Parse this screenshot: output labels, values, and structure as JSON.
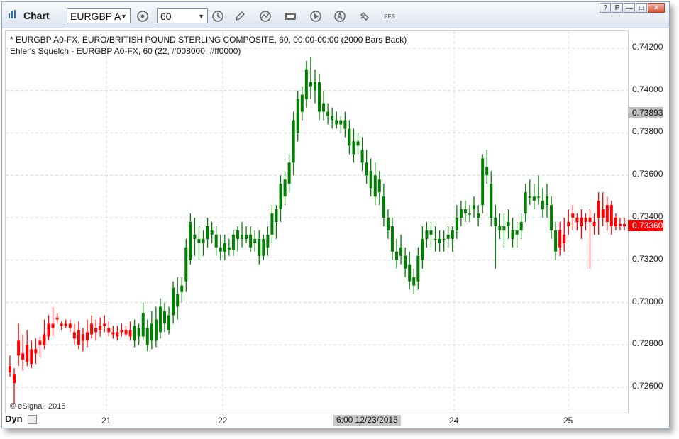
{
  "window": {
    "title": "Chart",
    "symbol": "EURGBP A",
    "interval": "60",
    "toolbar_efs": "EFS",
    "win_help": "?",
    "win_link": "P",
    "win_min": "—",
    "win_max": "□",
    "win_close": "✕"
  },
  "legend": {
    "line1": "* EURGBP A0-FX, EURO/BRITISH POUND STERLING COMPOSITE, 60, 00:00-00:00 (2000 Bars Back)",
    "line2": "Ehler's Squelch - EURGBP A0-FX, 60 (22, #008000, #ff0000)"
  },
  "footer": {
    "copyright": "© eSignal, 2015",
    "dyn": "Dyn",
    "crosshair_date": "6:00 12/23/2015"
  },
  "colors": {
    "up": "#008000",
    "down": "#ff0000",
    "grid": "#d8d8d8",
    "current_tag": "#ff0000",
    "crosshair_tag": "#c0c0c0"
  },
  "chart_data": {
    "type": "ohlc-bar",
    "y_ticks": [
      "0.72600",
      "0.72800",
      "0.73000",
      "0.73200",
      "0.73400",
      "0.73600",
      "0.73800",
      "0.74000",
      "0.74200"
    ],
    "ylim": [
      0.7248,
      0.7428
    ],
    "x_ticks": [
      "21",
      "22",
      "24",
      "25"
    ],
    "crosshair_price": "0.73893",
    "last_price": "0.73360",
    "series": [
      {
        "c": "r",
        "o": 0.727,
        "h": 0.7275,
        "l": 0.7265,
        "cl": 0.7267
      },
      {
        "c": "r",
        "o": 0.7266,
        "h": 0.7269,
        "l": 0.7252,
        "cl": 0.7262
      },
      {
        "c": "r",
        "o": 0.7282,
        "h": 0.729,
        "l": 0.727,
        "cl": 0.7275
      },
      {
        "c": "r",
        "o": 0.7273,
        "h": 0.7285,
        "l": 0.7268,
        "cl": 0.7276
      },
      {
        "c": "r",
        "o": 0.728,
        "h": 0.7287,
        "l": 0.727,
        "cl": 0.7272
      },
      {
        "c": "r",
        "o": 0.7278,
        "h": 0.7282,
        "l": 0.7269,
        "cl": 0.7271
      },
      {
        "c": "r",
        "o": 0.7278,
        "h": 0.7283,
        "l": 0.7271,
        "cl": 0.7276
      },
      {
        "c": "r",
        "o": 0.728,
        "h": 0.7284,
        "l": 0.7274,
        "cl": 0.7282
      },
      {
        "c": "r",
        "o": 0.7285,
        "h": 0.7292,
        "l": 0.7278,
        "cl": 0.728
      },
      {
        "c": "r",
        "o": 0.729,
        "h": 0.7294,
        "l": 0.7282,
        "cl": 0.7284
      },
      {
        "c": "r",
        "o": 0.729,
        "h": 0.7298,
        "l": 0.7284,
        "cl": 0.7288
      },
      {
        "c": "r",
        "o": 0.7293,
        "h": 0.7295,
        "l": 0.729,
        "cl": 0.7292
      },
      {
        "c": "r",
        "o": 0.7289,
        "h": 0.7291,
        "l": 0.7287,
        "cl": 0.729
      },
      {
        "c": "r",
        "o": 0.729,
        "h": 0.7292,
        "l": 0.7288,
        "cl": 0.7289
      },
      {
        "c": "r",
        "o": 0.729,
        "h": 0.7292,
        "l": 0.7286,
        "cl": 0.7288
      },
      {
        "c": "r",
        "o": 0.7286,
        "h": 0.729,
        "l": 0.728,
        "cl": 0.7283
      },
      {
        "c": "r",
        "o": 0.7287,
        "h": 0.7291,
        "l": 0.7278,
        "cl": 0.728
      },
      {
        "c": "r",
        "o": 0.7282,
        "h": 0.7288,
        "l": 0.7277,
        "cl": 0.7285
      },
      {
        "c": "r",
        "o": 0.7286,
        "h": 0.7292,
        "l": 0.7279,
        "cl": 0.7282
      },
      {
        "c": "r",
        "o": 0.729,
        "h": 0.7294,
        "l": 0.7283,
        "cl": 0.7285
      },
      {
        "c": "r",
        "o": 0.7286,
        "h": 0.7292,
        "l": 0.7282,
        "cl": 0.7288
      },
      {
        "c": "r",
        "o": 0.7289,
        "h": 0.7293,
        "l": 0.7284,
        "cl": 0.7287
      },
      {
        "c": "r",
        "o": 0.729,
        "h": 0.7294,
        "l": 0.7286,
        "cl": 0.7289
      },
      {
        "c": "r",
        "o": 0.7288,
        "h": 0.7291,
        "l": 0.7284,
        "cl": 0.7286
      },
      {
        "c": "r",
        "o": 0.7286,
        "h": 0.7289,
        "l": 0.7283,
        "cl": 0.7285
      },
      {
        "c": "r",
        "o": 0.7286,
        "h": 0.7289,
        "l": 0.7282,
        "cl": 0.7284
      },
      {
        "c": "r",
        "o": 0.7287,
        "h": 0.729,
        "l": 0.7284,
        "cl": 0.7286
      },
      {
        "c": "r",
        "o": 0.7287,
        "h": 0.7289,
        "l": 0.7284,
        "cl": 0.7285
      },
      {
        "c": "r",
        "o": 0.7287,
        "h": 0.7291,
        "l": 0.7282,
        "cl": 0.7284
      },
      {
        "c": "g",
        "o": 0.7282,
        "h": 0.7292,
        "l": 0.7279,
        "cl": 0.7289
      },
      {
        "c": "g",
        "o": 0.7284,
        "h": 0.729,
        "l": 0.728,
        "cl": 0.7288
      },
      {
        "c": "g",
        "o": 0.7284,
        "h": 0.73,
        "l": 0.7282,
        "cl": 0.7295
      },
      {
        "c": "g",
        "o": 0.728,
        "h": 0.7292,
        "l": 0.7277,
        "cl": 0.7288
      },
      {
        "c": "g",
        "o": 0.7282,
        "h": 0.7296,
        "l": 0.7278,
        "cl": 0.729
      },
      {
        "c": "g",
        "o": 0.7282,
        "h": 0.7298,
        "l": 0.7279,
        "cl": 0.7292
      },
      {
        "c": "g",
        "o": 0.7286,
        "h": 0.7302,
        "l": 0.7283,
        "cl": 0.7298
      },
      {
        "c": "g",
        "o": 0.729,
        "h": 0.73,
        "l": 0.7286,
        "cl": 0.7296
      },
      {
        "c": "g",
        "o": 0.7287,
        "h": 0.7298,
        "l": 0.7285,
        "cl": 0.7294
      },
      {
        "c": "g",
        "o": 0.7294,
        "h": 0.731,
        "l": 0.729,
        "cl": 0.7307
      },
      {
        "c": "g",
        "o": 0.7298,
        "h": 0.7312,
        "l": 0.7292,
        "cl": 0.7304
      },
      {
        "c": "g",
        "o": 0.7305,
        "h": 0.7312,
        "l": 0.73,
        "cl": 0.7308
      },
      {
        "c": "g",
        "o": 0.731,
        "h": 0.733,
        "l": 0.7305,
        "cl": 0.7326
      },
      {
        "c": "g",
        "o": 0.732,
        "h": 0.7342,
        "l": 0.7318,
        "cl": 0.7338
      },
      {
        "c": "g",
        "o": 0.733,
        "h": 0.734,
        "l": 0.7322,
        "cl": 0.7332
      },
      {
        "c": "g",
        "o": 0.7328,
        "h": 0.7336,
        "l": 0.732,
        "cl": 0.733
      },
      {
        "c": "g",
        "o": 0.7328,
        "h": 0.7334,
        "l": 0.7322,
        "cl": 0.733
      },
      {
        "c": "g",
        "o": 0.733,
        "h": 0.734,
        "l": 0.7326,
        "cl": 0.7336
      },
      {
        "c": "g",
        "o": 0.7334,
        "h": 0.7338,
        "l": 0.7328,
        "cl": 0.7332
      },
      {
        "c": "g",
        "o": 0.7332,
        "h": 0.7336,
        "l": 0.7322,
        "cl": 0.7326
      },
      {
        "c": "g",
        "o": 0.7326,
        "h": 0.7332,
        "l": 0.732,
        "cl": 0.7324
      },
      {
        "c": "g",
        "o": 0.7324,
        "h": 0.7332,
        "l": 0.732,
        "cl": 0.7328
      },
      {
        "c": "g",
        "o": 0.7326,
        "h": 0.733,
        "l": 0.7322,
        "cl": 0.7325
      },
      {
        "c": "g",
        "o": 0.7325,
        "h": 0.7334,
        "l": 0.7322,
        "cl": 0.7332
      },
      {
        "c": "g",
        "o": 0.733,
        "h": 0.7336,
        "l": 0.7324,
        "cl": 0.7334
      },
      {
        "c": "g",
        "o": 0.7332,
        "h": 0.7338,
        "l": 0.7326,
        "cl": 0.733
      },
      {
        "c": "g",
        "o": 0.733,
        "h": 0.7336,
        "l": 0.7328,
        "cl": 0.7332
      },
      {
        "c": "g",
        "o": 0.7332,
        "h": 0.7336,
        "l": 0.7324,
        "cl": 0.7326
      },
      {
        "c": "g",
        "o": 0.7328,
        "h": 0.7334,
        "l": 0.7324,
        "cl": 0.733
      },
      {
        "c": "g",
        "o": 0.733,
        "h": 0.7334,
        "l": 0.7318,
        "cl": 0.7322
      },
      {
        "c": "g",
        "o": 0.7322,
        "h": 0.7332,
        "l": 0.732,
        "cl": 0.733
      },
      {
        "c": "g",
        "o": 0.7326,
        "h": 0.7336,
        "l": 0.7322,
        "cl": 0.7332
      },
      {
        "c": "g",
        "o": 0.7332,
        "h": 0.7346,
        "l": 0.7328,
        "cl": 0.7342
      },
      {
        "c": "g",
        "o": 0.7338,
        "h": 0.7346,
        "l": 0.733,
        "cl": 0.7344
      },
      {
        "c": "g",
        "o": 0.7344,
        "h": 0.736,
        "l": 0.7338,
        "cl": 0.7356
      },
      {
        "c": "g",
        "o": 0.735,
        "h": 0.7362,
        "l": 0.7346,
        "cl": 0.7358
      },
      {
        "c": "g",
        "o": 0.7356,
        "h": 0.737,
        "l": 0.7352,
        "cl": 0.7366
      },
      {
        "c": "g",
        "o": 0.7366,
        "h": 0.739,
        "l": 0.736,
        "cl": 0.7386
      },
      {
        "c": "g",
        "o": 0.738,
        "h": 0.74,
        "l": 0.7376,
        "cl": 0.7396
      },
      {
        "c": "g",
        "o": 0.739,
        "h": 0.7402,
        "l": 0.7386,
        "cl": 0.7398
      },
      {
        "c": "g",
        "o": 0.7396,
        "h": 0.7414,
        "l": 0.7392,
        "cl": 0.741
      },
      {
        "c": "g",
        "o": 0.7404,
        "h": 0.7416,
        "l": 0.7396,
        "cl": 0.7402
      },
      {
        "c": "g",
        "o": 0.74,
        "h": 0.741,
        "l": 0.7394,
        "cl": 0.7404
      },
      {
        "c": "g",
        "o": 0.7404,
        "h": 0.7408,
        "l": 0.7386,
        "cl": 0.739
      },
      {
        "c": "g",
        "o": 0.7394,
        "h": 0.74,
        "l": 0.7386,
        "cl": 0.739
      },
      {
        "c": "g",
        "o": 0.739,
        "h": 0.7394,
        "l": 0.7384,
        "cl": 0.7388
      },
      {
        "c": "g",
        "o": 0.7388,
        "h": 0.7392,
        "l": 0.7382,
        "cl": 0.7386
      },
      {
        "c": "g",
        "o": 0.7386,
        "h": 0.739,
        "l": 0.7382,
        "cl": 0.7384
      },
      {
        "c": "g",
        "o": 0.7386,
        "h": 0.7388,
        "l": 0.738,
        "cl": 0.7384
      },
      {
        "c": "g",
        "o": 0.7386,
        "h": 0.739,
        "l": 0.7378,
        "cl": 0.7382
      },
      {
        "c": "g",
        "o": 0.7382,
        "h": 0.7386,
        "l": 0.737,
        "cl": 0.7374
      },
      {
        "c": "g",
        "o": 0.7376,
        "h": 0.7382,
        "l": 0.7366,
        "cl": 0.737
      },
      {
        "c": "g",
        "o": 0.7376,
        "h": 0.738,
        "l": 0.737,
        "cl": 0.7374
      },
      {
        "c": "g",
        "o": 0.7372,
        "h": 0.7378,
        "l": 0.7362,
        "cl": 0.7366
      },
      {
        "c": "g",
        "o": 0.7366,
        "h": 0.7372,
        "l": 0.7356,
        "cl": 0.736
      },
      {
        "c": "g",
        "o": 0.7362,
        "h": 0.7368,
        "l": 0.735,
        "cl": 0.7354
      },
      {
        "c": "g",
        "o": 0.736,
        "h": 0.7366,
        "l": 0.7346,
        "cl": 0.735
      },
      {
        "c": "g",
        "o": 0.7358,
        "h": 0.7362,
        "l": 0.7346,
        "cl": 0.7352
      },
      {
        "c": "g",
        "o": 0.735,
        "h": 0.7356,
        "l": 0.7336,
        "cl": 0.734
      },
      {
        "c": "g",
        "o": 0.734,
        "h": 0.7344,
        "l": 0.733,
        "cl": 0.7334
      },
      {
        "c": "g",
        "o": 0.7336,
        "h": 0.734,
        "l": 0.732,
        "cl": 0.7324
      },
      {
        "c": "g",
        "o": 0.7324,
        "h": 0.733,
        "l": 0.7316,
        "cl": 0.732
      },
      {
        "c": "g",
        "o": 0.7322,
        "h": 0.7332,
        "l": 0.7318,
        "cl": 0.7326
      },
      {
        "c": "g",
        "o": 0.7322,
        "h": 0.7326,
        "l": 0.7312,
        "cl": 0.7316
      },
      {
        "c": "g",
        "o": 0.7318,
        "h": 0.7324,
        "l": 0.7306,
        "cl": 0.731
      },
      {
        "c": "g",
        "o": 0.7312,
        "h": 0.7316,
        "l": 0.7304,
        "cl": 0.7308
      },
      {
        "c": "g",
        "o": 0.731,
        "h": 0.7326,
        "l": 0.7306,
        "cl": 0.7322
      },
      {
        "c": "g",
        "o": 0.732,
        "h": 0.7336,
        "l": 0.7316,
        "cl": 0.733
      },
      {
        "c": "g",
        "o": 0.733,
        "h": 0.7338,
        "l": 0.7326,
        "cl": 0.7334
      },
      {
        "c": "g",
        "o": 0.7332,
        "h": 0.7338,
        "l": 0.7326,
        "cl": 0.7334
      },
      {
        "c": "g",
        "o": 0.733,
        "h": 0.7336,
        "l": 0.7324,
        "cl": 0.733
      },
      {
        "c": "g",
        "o": 0.7328,
        "h": 0.7334,
        "l": 0.7324,
        "cl": 0.733
      },
      {
        "c": "g",
        "o": 0.733,
        "h": 0.7334,
        "l": 0.7324,
        "cl": 0.733
      },
      {
        "c": "g",
        "o": 0.733,
        "h": 0.7336,
        "l": 0.7326,
        "cl": 0.7332
      },
      {
        "c": "g",
        "o": 0.733,
        "h": 0.7336,
        "l": 0.7324,
        "cl": 0.7334
      },
      {
        "c": "g",
        "o": 0.7334,
        "h": 0.7346,
        "l": 0.733,
        "cl": 0.734
      },
      {
        "c": "g",
        "o": 0.734,
        "h": 0.7348,
        "l": 0.7336,
        "cl": 0.7344
      },
      {
        "c": "g",
        "o": 0.7342,
        "h": 0.7348,
        "l": 0.7338,
        "cl": 0.7344
      },
      {
        "c": "g",
        "o": 0.7342,
        "h": 0.7346,
        "l": 0.7338,
        "cl": 0.7342
      },
      {
        "c": "g",
        "o": 0.7344,
        "h": 0.735,
        "l": 0.734,
        "cl": 0.7346
      },
      {
        "c": "g",
        "o": 0.7342,
        "h": 0.7346,
        "l": 0.7336,
        "cl": 0.734
      },
      {
        "c": "g",
        "o": 0.7346,
        "h": 0.737,
        "l": 0.7342,
        "cl": 0.7368
      },
      {
        "c": "g",
        "o": 0.736,
        "h": 0.7372,
        "l": 0.7356,
        "cl": 0.7364
      },
      {
        "c": "g",
        "o": 0.7356,
        "h": 0.7362,
        "l": 0.7336,
        "cl": 0.734
      },
      {
        "c": "g",
        "o": 0.734,
        "h": 0.7346,
        "l": 0.7316,
        "cl": 0.7336
      },
      {
        "c": "g",
        "o": 0.7336,
        "h": 0.7342,
        "l": 0.733,
        "cl": 0.7334
      },
      {
        "c": "g",
        "o": 0.7334,
        "h": 0.7342,
        "l": 0.7326,
        "cl": 0.7336
      },
      {
        "c": "g",
        "o": 0.7336,
        "h": 0.7344,
        "l": 0.733,
        "cl": 0.7338
      },
      {
        "c": "g",
        "o": 0.7334,
        "h": 0.734,
        "l": 0.7326,
        "cl": 0.733
      },
      {
        "c": "g",
        "o": 0.7332,
        "h": 0.7338,
        "l": 0.7326,
        "cl": 0.7334
      },
      {
        "c": "g",
        "o": 0.7334,
        "h": 0.7342,
        "l": 0.733,
        "cl": 0.7338
      },
      {
        "c": "g",
        "o": 0.7342,
        "h": 0.7356,
        "l": 0.7338,
        "cl": 0.7352
      },
      {
        "c": "g",
        "o": 0.735,
        "h": 0.7358,
        "l": 0.7346,
        "cl": 0.735
      },
      {
        "c": "g",
        "o": 0.735,
        "h": 0.7356,
        "l": 0.7344,
        "cl": 0.7348
      },
      {
        "c": "g",
        "o": 0.735,
        "h": 0.736,
        "l": 0.7346,
        "cl": 0.735
      },
      {
        "c": "g",
        "o": 0.7348,
        "h": 0.7354,
        "l": 0.734,
        "cl": 0.7344
      },
      {
        "c": "g",
        "o": 0.7346,
        "h": 0.7356,
        "l": 0.734,
        "cl": 0.735
      },
      {
        "c": "g",
        "o": 0.7346,
        "h": 0.735,
        "l": 0.733,
        "cl": 0.7334
      },
      {
        "c": "g",
        "o": 0.7334,
        "h": 0.7338,
        "l": 0.732,
        "cl": 0.7324
      },
      {
        "c": "r",
        "o": 0.7334,
        "h": 0.7338,
        "l": 0.7322,
        "cl": 0.7326
      },
      {
        "c": "r",
        "o": 0.7332,
        "h": 0.734,
        "l": 0.7324,
        "cl": 0.7328
      },
      {
        "c": "r",
        "o": 0.7338,
        "h": 0.7344,
        "l": 0.7332,
        "cl": 0.7336
      },
      {
        "c": "r",
        "o": 0.734,
        "h": 0.7346,
        "l": 0.7334,
        "cl": 0.7342
      },
      {
        "c": "r",
        "o": 0.734,
        "h": 0.7342,
        "l": 0.7334,
        "cl": 0.7338
      },
      {
        "c": "r",
        "o": 0.734,
        "h": 0.7344,
        "l": 0.733,
        "cl": 0.7336
      },
      {
        "c": "r",
        "o": 0.7338,
        "h": 0.7342,
        "l": 0.7334,
        "cl": 0.734
      },
      {
        "c": "r",
        "o": 0.734,
        "h": 0.7344,
        "l": 0.7316,
        "cl": 0.7338
      },
      {
        "c": "r",
        "o": 0.7338,
        "h": 0.7342,
        "l": 0.7332,
        "cl": 0.7336
      },
      {
        "c": "r",
        "o": 0.734,
        "h": 0.7352,
        "l": 0.7332,
        "cl": 0.7348
      },
      {
        "c": "r",
        "o": 0.7344,
        "h": 0.7352,
        "l": 0.7336,
        "cl": 0.734
      },
      {
        "c": "r",
        "o": 0.7346,
        "h": 0.735,
        "l": 0.7334,
        "cl": 0.7338
      },
      {
        "c": "r",
        "o": 0.7346,
        "h": 0.7348,
        "l": 0.7332,
        "cl": 0.7336
      },
      {
        "c": "r",
        "o": 0.734,
        "h": 0.7342,
        "l": 0.7334,
        "cl": 0.7336
      },
      {
        "c": "r",
        "o": 0.7336,
        "h": 0.734,
        "l": 0.7334,
        "cl": 0.7337
      },
      {
        "c": "r",
        "o": 0.7337,
        "h": 0.734,
        "l": 0.7334,
        "cl": 0.7336
      }
    ]
  }
}
